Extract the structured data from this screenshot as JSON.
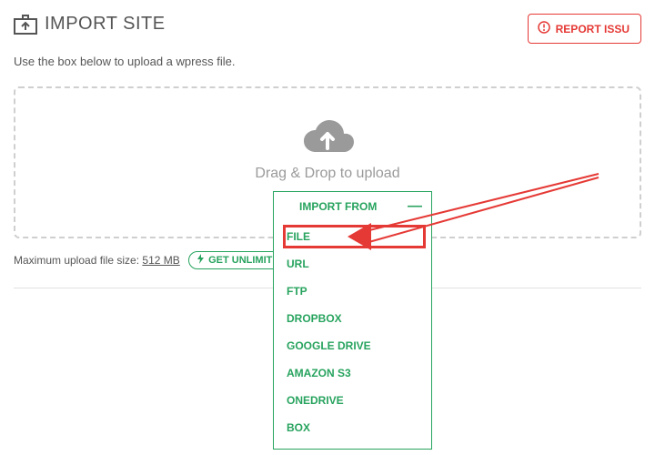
{
  "header": {
    "title": "IMPORT SITE",
    "report_label": "REPORT ISSU"
  },
  "instruction": "Use the box below to upload a wpress file.",
  "dropzone": {
    "text": "Drag & Drop to upload"
  },
  "dropdown": {
    "header_label": "IMPORT FROM",
    "toggle_icon": "—",
    "items": [
      "FILE",
      "URL",
      "FTP",
      "DROPBOX",
      "GOOGLE DRIVE",
      "AMAZON S3",
      "ONEDRIVE",
      "BOX"
    ]
  },
  "max_upload": {
    "prefix": "Maximum upload file size: ",
    "size": "512 MB",
    "unlimited_label": "GET UNLIMITED"
  },
  "colors": {
    "green": "#27a35e",
    "red": "#e53935",
    "gray": "#9a9a9a"
  }
}
